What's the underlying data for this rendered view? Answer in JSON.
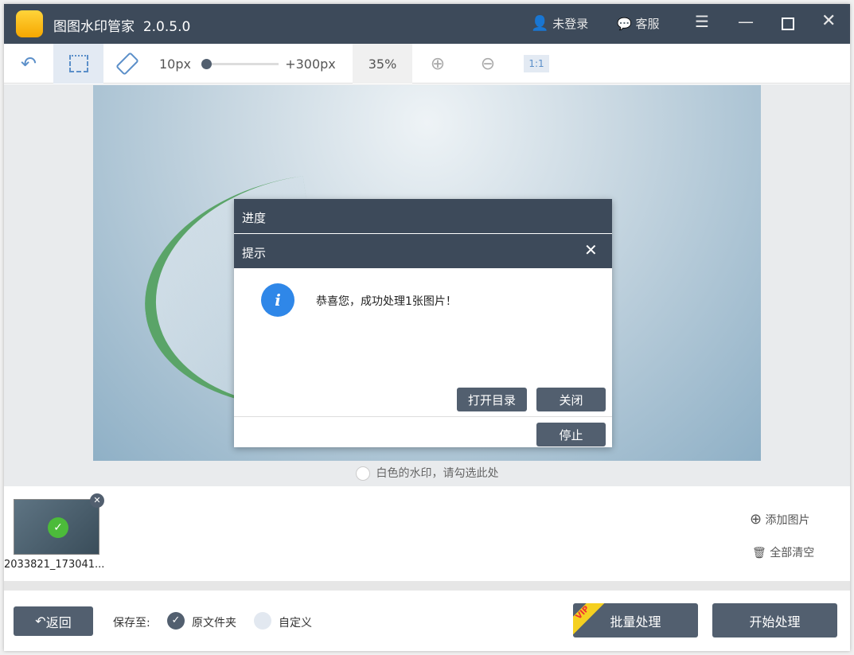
{
  "app": {
    "title": "图图水印管家",
    "version": "2.0.5.0",
    "login": "未登录",
    "service": "客服"
  },
  "toolbar": {
    "min_size": "10px",
    "max_size": "+300px",
    "slider_fraction": 0.0,
    "zoom": "35%",
    "actual_size": "1:1"
  },
  "canvas": {
    "white_watermark_hint": "白色的水印，请勾选此处"
  },
  "dialog": {
    "progress_title": "进度",
    "title": "提示",
    "message": "恭喜您，成功处理1张图片！",
    "open_dir": "打开目录",
    "close": "关闭",
    "stop": "停止"
  },
  "strip": {
    "thumb_name": "2033821_173041...",
    "add": "添加图片",
    "clear": "全部清空"
  },
  "bottom": {
    "back": "返回",
    "save_to": "保存至:",
    "option_original": "原文件夹",
    "option_custom": "自定义",
    "batch": "批量处理",
    "vip": "VIP",
    "start": "开始处理"
  },
  "colors": {
    "titlebar": "#3d4a5a",
    "button": "#525f6f",
    "accent": "#5b8fc9",
    "info": "#2f87e8"
  }
}
